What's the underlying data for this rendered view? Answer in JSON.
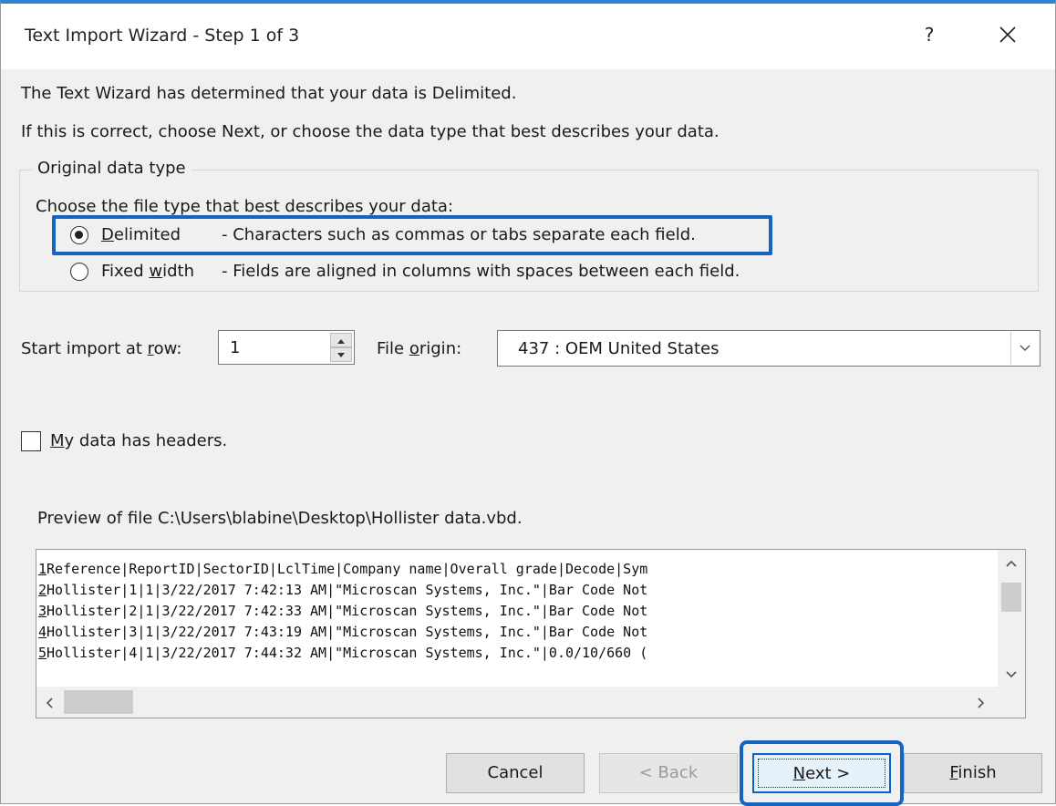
{
  "window": {
    "title": "Text Import Wizard - Step 1 of 3",
    "help_label": "?"
  },
  "intro": {
    "line1": "The Text Wizard has determined that your data is Delimited.",
    "line2": "If this is correct, choose Next, or choose the data type that best describes your data."
  },
  "original_data_type": {
    "legend": "Original data type",
    "prompt": "Choose the file type that best describes your data:",
    "options": [
      {
        "label_hot": "D",
        "label_rest": "elimited",
        "description": "- Characters such as commas or tabs separate each field.",
        "selected": true
      },
      {
        "label_pre": "Fixed ",
        "label_hot": "w",
        "label_rest": "idth",
        "description": "- Fields are aligned in columns with spaces between each field.",
        "selected": false
      }
    ]
  },
  "start_row": {
    "label_pre": "Start import at ",
    "label_hot": "r",
    "label_rest": "ow:",
    "value": "1"
  },
  "file_origin": {
    "label_pre": "File ",
    "label_hot": "o",
    "label_rest": "rigin:",
    "value": "437 : OEM United States"
  },
  "headers_checkbox": {
    "label_hot": "M",
    "label_rest": "y data has headers.",
    "checked": false
  },
  "preview": {
    "caption": "Preview of file C:\\Users\\blabine\\Desktop\\Hollister data.vbd.",
    "lines": [
      {
        "num": "1",
        "text": "Reference|ReportID|SectorID|LclTime|Company name|Overall grade|Decode|Sym"
      },
      {
        "num": "2",
        "text": "Hollister|1|1|3/22/2017 7:42:13 AM|\"Microscan Systems, Inc.\"|Bar Code Not"
      },
      {
        "num": "3",
        "text": "Hollister|2|1|3/22/2017 7:42:33 AM|\"Microscan Systems, Inc.\"|Bar Code Not"
      },
      {
        "num": "4",
        "text": "Hollister|3|1|3/22/2017 7:43:19 AM|\"Microscan Systems, Inc.\"|Bar Code Not"
      },
      {
        "num": "5",
        "text": "Hollister|4|1|3/22/2017 7:44:32 AM|\"Microscan Systems, Inc.\"|0.0/10/660 ("
      }
    ]
  },
  "buttons": {
    "cancel": "Cancel",
    "back": "< Back",
    "next_hot": "N",
    "next_rest": "ext >",
    "finish_hot": "F",
    "finish_rest": "inish"
  },
  "colors": {
    "title_border": "#2f83d1",
    "highlight": "#1565c0",
    "default_button_border": "#0a64c8"
  }
}
